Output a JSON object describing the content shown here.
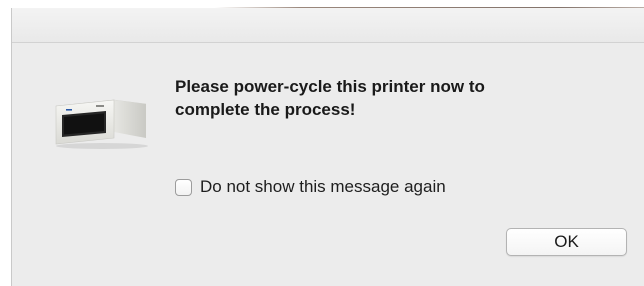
{
  "dialog": {
    "message": "Please power-cycle this printer now to\ncomplete the process!",
    "checkbox": {
      "label": "Do not show this message again",
      "checked": false
    },
    "ok_button_label": "OK"
  },
  "icons": {
    "app_icon": "printer-icon"
  }
}
